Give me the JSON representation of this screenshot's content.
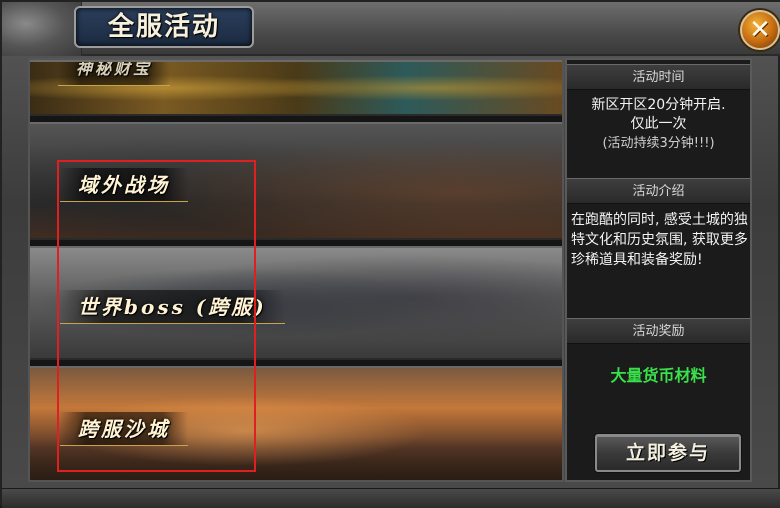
{
  "window": {
    "title": "全服活动",
    "close_icon": "✕"
  },
  "banners": [
    {
      "id": "treasure",
      "label": "神秘财宝"
    },
    {
      "id": "field",
      "label": "域外战场"
    },
    {
      "id": "boss",
      "label": "世界boss (跨服)"
    },
    {
      "id": "city",
      "label": "跨服沙城"
    }
  ],
  "info": {
    "time_header": "活动时间",
    "time_lines": [
      "新区开区20分钟开启.",
      "仅此一次",
      "(活动持续3分钟!!!)"
    ],
    "intro_header": "活动介绍",
    "intro_text": "在跑酷的同时, 感受土城的独特文化和历史氛围, 获取更多珍稀道具和装备奖励!",
    "reward_header": "活动奖励",
    "reward_text": "大量货币材料",
    "join_button": "立即参与"
  },
  "colors": {
    "reward_text": "#39e04a",
    "selection_outline": "#e02020",
    "title_plate": "#1b2a40",
    "close_button": "#c46a10"
  }
}
